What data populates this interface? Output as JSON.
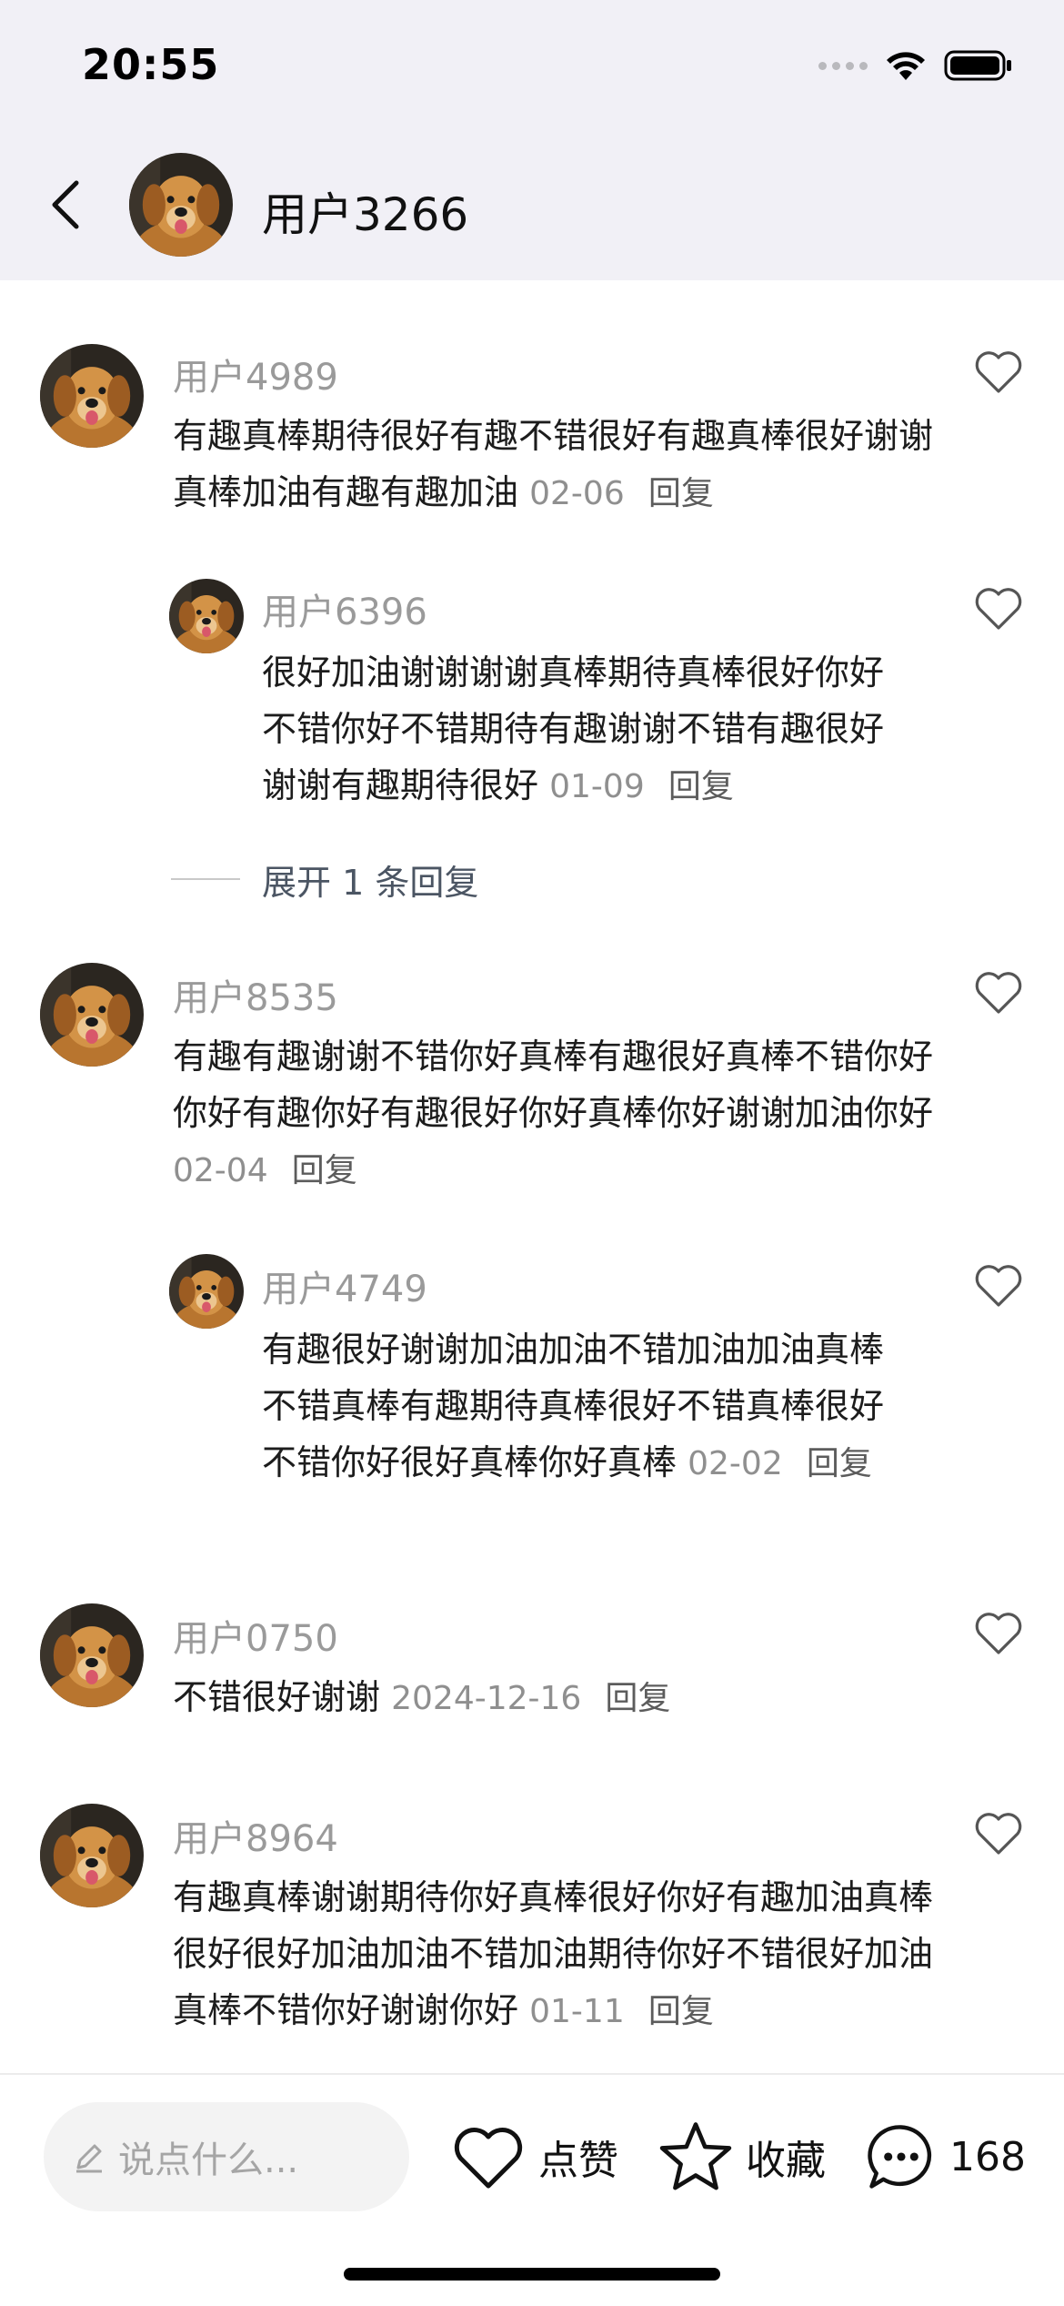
{
  "status_bar": {
    "time": "20:55"
  },
  "header": {
    "username": "用户3266"
  },
  "comments": [
    {
      "user": "用户4989",
      "text": "有趣真棒期待很好有趣不错很好有趣真棒很好谢谢真棒加油有趣有趣加油",
      "date": "02-06",
      "reply_label": "回复"
    },
    {
      "user": "用户6396",
      "text": "很好加油谢谢谢谢真棒期待真棒很好你好不错你好不错期待有趣谢谢不错有趣很好谢谢有趣期待很好",
      "date": "01-09",
      "reply_label": "回复"
    },
    {
      "user": "用户8535",
      "text": "有趣有趣谢谢不错你好真棒有趣很好真棒不错你好你好有趣你好有趣很好你好真棒你好谢谢加油你好",
      "date": "02-04",
      "reply_label": "回复"
    },
    {
      "user": "用户4749",
      "text": "有趣很好谢谢加油加油不错加油加油真棒不错真棒有趣期待真棒很好不错真棒很好不错你好很好真棒你好真棒",
      "date": "02-02",
      "reply_label": "回复"
    },
    {
      "user": "用户0750",
      "text": "不错很好谢谢",
      "date": "2024-12-16",
      "reply_label": "回复"
    },
    {
      "user": "用户8964",
      "text": "有趣真棒谢谢期待你好真棒很好你好有趣加油真棒很好很好加油加油不错加油期待你好不错很好加油真棒不错你好谢谢你好",
      "date": "01-11",
      "reply_label": "回复"
    }
  ],
  "expand_replies": "展开 1 条回复",
  "bottom_bar": {
    "input_placeholder": "说点什么...",
    "like_label": "点赞",
    "favorite_label": "收藏",
    "comment_count": "168"
  }
}
